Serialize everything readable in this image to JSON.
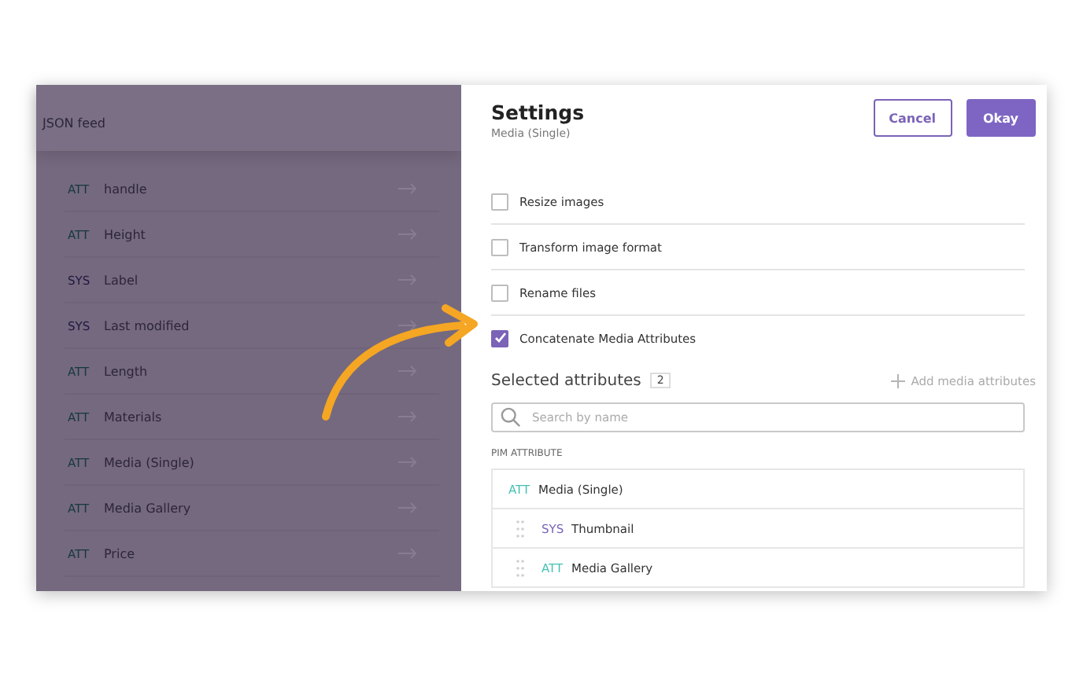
{
  "feed_panel": {
    "title": "JSON feed",
    "rows": [
      {
        "tag": "ATT",
        "name": "handle"
      },
      {
        "tag": "ATT",
        "name": "Height"
      },
      {
        "tag": "SYS",
        "name": "Label"
      },
      {
        "tag": "SYS",
        "name": "Last modified"
      },
      {
        "tag": "ATT",
        "name": "Length"
      },
      {
        "tag": "ATT",
        "name": "Materials"
      },
      {
        "tag": "ATT",
        "name": "Media (Single)"
      },
      {
        "tag": "ATT",
        "name": "Media Gallery"
      },
      {
        "tag": "ATT",
        "name": "Price"
      }
    ]
  },
  "settings": {
    "title": "Settings",
    "subtitle": "Media (Single)",
    "buttons": [
      {
        "label": "Cancel",
        "kind": "secondary"
      },
      {
        "label": "Okay",
        "kind": "primary"
      }
    ],
    "options": [
      {
        "label": "Resize images",
        "checked": false
      },
      {
        "label": "Transform image format",
        "checked": false
      },
      {
        "label": "Rename files",
        "checked": false
      },
      {
        "label": "Concatenate Media Attributes",
        "checked": true
      }
    ],
    "selected_attributes": {
      "heading": "Selected attributes",
      "count": "2",
      "add_label": "Add media attributes",
      "search": {
        "placeholder": "Search by name"
      },
      "column": "PIM ATTRIBUTE",
      "items": [
        {
          "tag": "ATT",
          "name": "Media (Single)",
          "children": [
            {
              "tag": "SYS",
              "name": "Thumbnail"
            },
            {
              "tag": "ATT",
              "name": "Media Gallery"
            }
          ]
        }
      ]
    }
  }
}
